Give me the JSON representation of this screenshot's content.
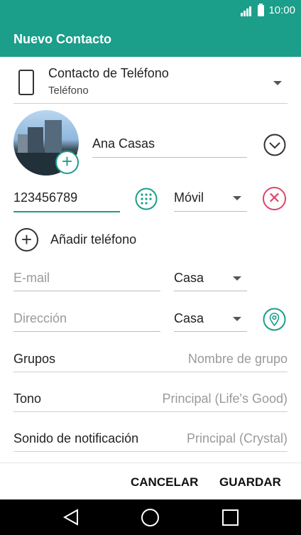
{
  "status_bar": {
    "time": "10:00",
    "signal_icon": "signal-icon",
    "battery_icon": "battery-icon"
  },
  "app_bar": {
    "title": "Nuevo Contacto",
    "background": "#1b9e8a"
  },
  "account": {
    "name": "Contacto de Teléfono",
    "type": "Teléfono",
    "icon": "phone-icon"
  },
  "name_field": {
    "value": "Ana Casas"
  },
  "phone": {
    "value": "123456789",
    "type": "Móvil"
  },
  "add_phone": {
    "label": "Añadir teléfono"
  },
  "email": {
    "placeholder": "E-mail",
    "type": "Casa"
  },
  "address": {
    "placeholder": "Dirección",
    "type": "Casa"
  },
  "rows": [
    {
      "label": "Grupos",
      "value": "Nombre de grupo"
    },
    {
      "label": "Tono",
      "value": "Principal (Life's Good)"
    },
    {
      "label": "Sonido de notificación",
      "value": "Principal (Crystal)"
    }
  ],
  "actions": {
    "cancel": "CANCELAR",
    "save": "GUARDAR"
  },
  "colors": {
    "accent": "#1b9e8a",
    "danger": "#e0436a"
  }
}
